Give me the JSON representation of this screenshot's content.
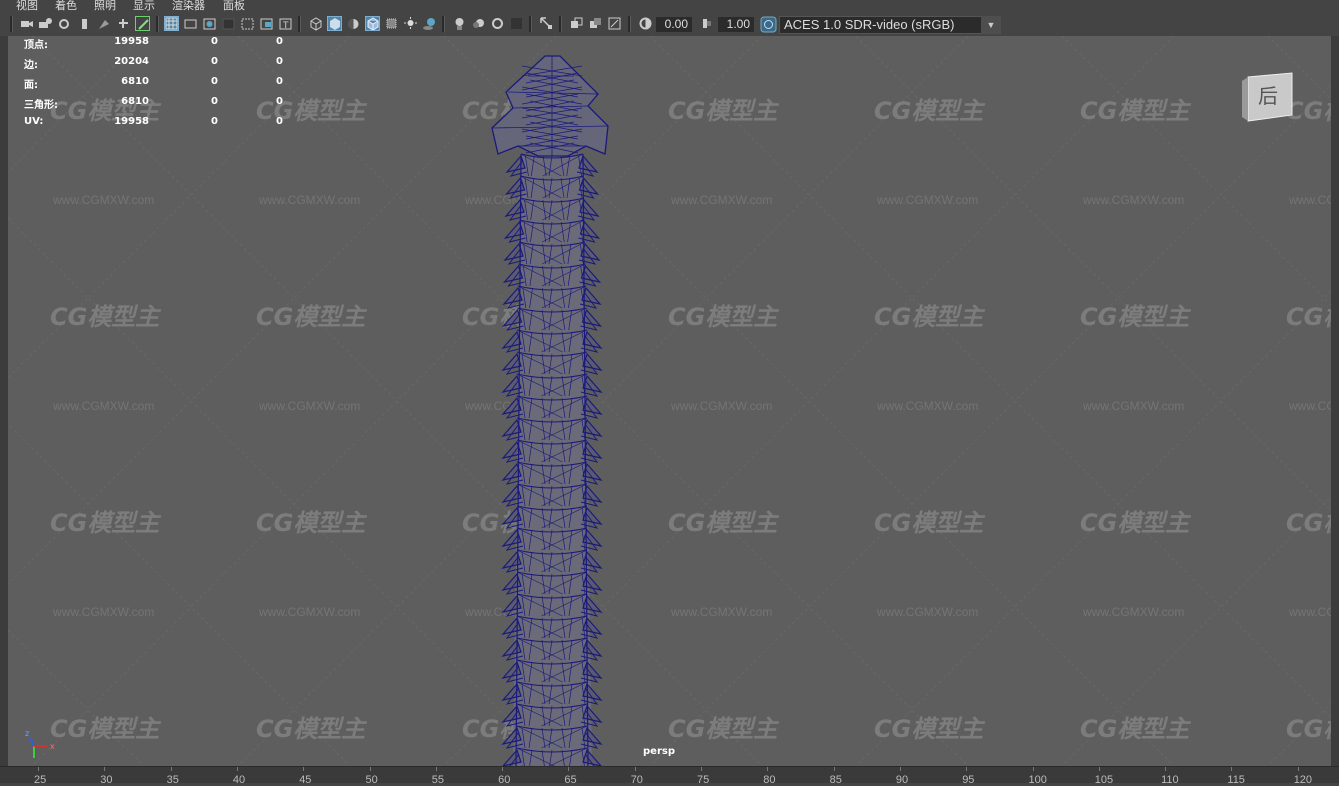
{
  "menu": [
    "视图",
    "着色",
    "照明",
    "显示",
    "渲染器",
    "面板"
  ],
  "toolbar": {
    "exposure_value": "0.00",
    "gamma_value": "1.00",
    "color_space": "ACES 1.0 SDR-video (sRGB)"
  },
  "hud": {
    "rows": [
      {
        "label": "顶点:",
        "v1": "19958",
        "v2": "0",
        "v3": "0"
      },
      {
        "label": "边:",
        "v1": "20204",
        "v2": "0",
        "v3": "0"
      },
      {
        "label": "面:",
        "v1": "6810",
        "v2": "0",
        "v3": "0"
      },
      {
        "label": "三角形:",
        "v1": "6810",
        "v2": "0",
        "v3": "0"
      },
      {
        "label": "UV:",
        "v1": "19958",
        "v2": "0",
        "v3": "0"
      }
    ]
  },
  "camera_name": "persp",
  "viewcube_label": "后",
  "axis": {
    "x": "x",
    "y": "y",
    "z": "z"
  },
  "timeline_ticks": [
    "25",
    "30",
    "35",
    "40",
    "45",
    "50",
    "55",
    "60",
    "65",
    "70",
    "75",
    "80",
    "85",
    "90",
    "95",
    "100",
    "105",
    "110",
    "115",
    "120"
  ],
  "watermark": {
    "logo": "CG模型主",
    "url": "www.CGMXW.com"
  },
  "colors": {
    "viewport_bg": "#5e5e5e",
    "wireframe": "#1b1a7a",
    "ui_bg": "#444444",
    "selected_button": "#5285a6"
  }
}
